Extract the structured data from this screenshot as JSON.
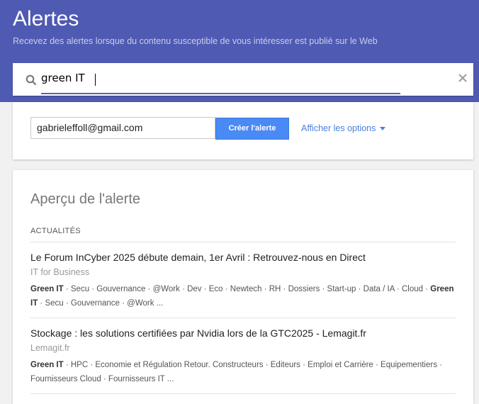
{
  "header": {
    "title": "Alertes",
    "subtitle": "Recevez des alertes lorsque du contenu susceptible de vous intéresser est publié sur le Web",
    "background_color": "#4f5ab3"
  },
  "search": {
    "value": "green IT",
    "icon": "search-icon",
    "clear_icon": "close-icon"
  },
  "options_card": {
    "email": "gabrieleffoll@gmail.com",
    "create_label": "Créer l'alerte",
    "show_options_label": "Afficher les options",
    "accent_color": "#4a8af4"
  },
  "preview": {
    "title": "Aperçu de l'alerte",
    "section_label": "ACTUALITÉS",
    "items": [
      {
        "title": "Le Forum InCyber 2025 débute demain, 1er Avril : Retrouvez-nous en Direct",
        "source": "IT for Business",
        "tags_bold1": "Green IT",
        "tags_middle": " · Secu · Gouvernance · @Work · Dev · Eco · Newtech · RH · Dossiers · Start-up · Data / IA · Cloud · ",
        "tags_bold2": "Green IT",
        "tags_end": " · Secu · Gouvernance · @Work ..."
      },
      {
        "title": "Stockage : les solutions certifiées par Nvidia lors de la GTC2025 - Lemagit.fr",
        "source": "Lemagit.fr",
        "tags_bold1": "Green IT",
        "tags_middle": " · HPC · Economie et Régulation Retour. Constructeurs · Editeurs · Emploi et Carrière · Equipementiers · Fournisseurs Cloud · Fournisseurs IT ...",
        "tags_bold2": "",
        "tags_end": ""
      }
    ]
  }
}
